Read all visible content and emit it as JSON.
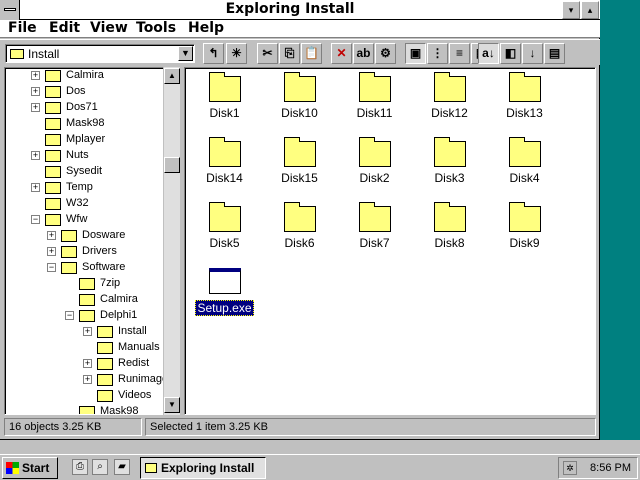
{
  "window": {
    "title": "Exploring Install",
    "minimize_glyph": "▾",
    "maximize_glyph": "▴"
  },
  "menu": [
    {
      "label": "File"
    },
    {
      "label": "Edit"
    },
    {
      "label": "View"
    },
    {
      "label": "Tools"
    },
    {
      "label": "Help"
    }
  ],
  "toolbar": {
    "location_value": "Install",
    "location_arrow": "▼",
    "buttons": [
      {
        "icon": "up-folder-icon",
        "glyph": "↰"
      },
      {
        "icon": "new-folder-icon",
        "glyph": "✳"
      },
      {
        "icon": "cut-icon",
        "glyph": "✂"
      },
      {
        "icon": "copy-icon",
        "glyph": "⎘"
      },
      {
        "icon": "paste-icon",
        "glyph": "📋"
      },
      {
        "icon": "delete-icon",
        "glyph": "✕"
      },
      {
        "icon": "rename-icon",
        "glyph": "ab"
      },
      {
        "icon": "properties-icon",
        "glyph": "⚙"
      },
      {
        "icon": "large-icons-icon",
        "glyph": "▣"
      },
      {
        "icon": "small-icons-icon",
        "glyph": "⋮"
      },
      {
        "icon": "list-icon",
        "glyph": "≡"
      },
      {
        "icon": "details-icon",
        "glyph": "▦"
      },
      {
        "icon": "sort-name-icon",
        "glyph": "a↓"
      },
      {
        "icon": "sort-type-icon",
        "glyph": "◧"
      },
      {
        "icon": "sort-size-icon",
        "glyph": "↓"
      },
      {
        "icon": "sort-date-icon",
        "glyph": "▤"
      }
    ]
  },
  "tree": [
    {
      "label": "Calmira",
      "expander": "+"
    },
    {
      "label": "Dos",
      "expander": "+"
    },
    {
      "label": "Dos71",
      "expander": "+"
    },
    {
      "label": "Mask98",
      "expander": ""
    },
    {
      "label": "Mplayer",
      "expander": ""
    },
    {
      "label": "Nuts",
      "expander": "+"
    },
    {
      "label": "Sysedit",
      "expander": ""
    },
    {
      "label": "Temp",
      "expander": "+"
    },
    {
      "label": "W32",
      "expander": ""
    },
    {
      "label": "Wfw",
      "expander": "−"
    },
    {
      "label": "Dosware",
      "expander": "+"
    },
    {
      "label": "Drivers",
      "expander": "+"
    },
    {
      "label": "Software",
      "expander": "−"
    },
    {
      "label": "7zip",
      "expander": ""
    },
    {
      "label": "Calmira",
      "expander": ""
    },
    {
      "label": "Delphi1",
      "expander": "−"
    },
    {
      "label": "Install",
      "expander": "+"
    },
    {
      "label": "Manuals",
      "expander": ""
    },
    {
      "label": "Redist",
      "expander": "+"
    },
    {
      "label": "Runimage",
      "expander": "+"
    },
    {
      "label": "Videos",
      "expander": ""
    },
    {
      "label": "Mask98",
      "expander": ""
    }
  ],
  "scroll": {
    "up": "▲",
    "down": "▼"
  },
  "files": [
    {
      "label": "Disk1"
    },
    {
      "label": "Disk10"
    },
    {
      "label": "Disk11"
    },
    {
      "label": "Disk12"
    },
    {
      "label": "Disk13"
    },
    {
      "label": "Disk14"
    },
    {
      "label": "Disk15"
    },
    {
      "label": "Disk2"
    },
    {
      "label": "Disk3"
    },
    {
      "label": "Disk4"
    },
    {
      "label": "Disk5"
    },
    {
      "label": "Disk6"
    },
    {
      "label": "Disk7"
    },
    {
      "label": "Disk8"
    },
    {
      "label": "Disk9"
    }
  ],
  "selected_file": {
    "label": "Setup.exe"
  },
  "status": {
    "left": "16 objects  3.25 KB",
    "right": "Selected 1 item  3.25 KB"
  },
  "taskbar": {
    "start": "Start",
    "task": "Exploring Install",
    "clock": "8:56 PM"
  }
}
